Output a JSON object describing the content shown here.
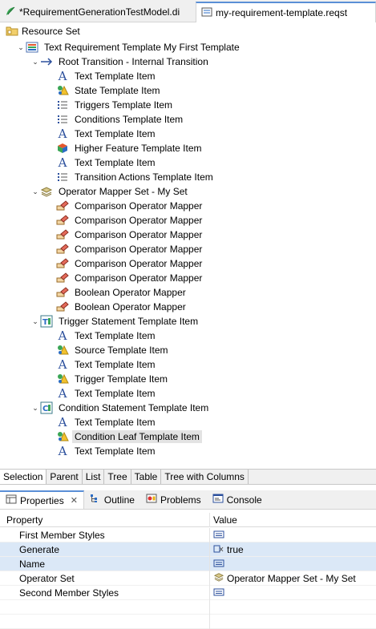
{
  "editor_tabs": [
    {
      "label": "*RequirementGenerationTestModel.di",
      "icon": "papyrus-icon"
    },
    {
      "label": "my-requirement-template.reqst",
      "icon": "reqst-icon"
    }
  ],
  "resource_set": {
    "label": "Resource Set",
    "icon": "resource-set-icon"
  },
  "tree": [
    {
      "label": "Text Requirement Template My First Template",
      "icon": "template-icon",
      "depth": 1,
      "expanded": true
    },
    {
      "label": "Root Transition - Internal Transition",
      "icon": "transition-arrow-icon",
      "depth": 2,
      "expanded": true
    },
    {
      "label": "Text Template Item",
      "icon": "text-a-icon",
      "depth": 3
    },
    {
      "label": "State Template Item",
      "icon": "state-icon",
      "depth": 3
    },
    {
      "label": "Triggers Template Item",
      "icon": "list-icon",
      "depth": 3
    },
    {
      "label": "Conditions Template Item",
      "icon": "list-icon",
      "depth": 3
    },
    {
      "label": "Text Template Item",
      "icon": "text-a-icon",
      "depth": 3
    },
    {
      "label": "Higher Feature Template Item",
      "icon": "cube-icon",
      "depth": 3
    },
    {
      "label": "Text Template Item",
      "icon": "text-a-icon",
      "depth": 3
    },
    {
      "label": "Transition Actions Template Item",
      "icon": "list-icon",
      "depth": 3
    },
    {
      "label": "Operator Mapper Set - My Set",
      "icon": "mapper-set-icon",
      "depth": 2,
      "expanded": true
    },
    {
      "label": "Comparison Operator Mapper",
      "icon": "mapper-icon",
      "depth": 3
    },
    {
      "label": "Comparison Operator Mapper",
      "icon": "mapper-icon",
      "depth": 3
    },
    {
      "label": "Comparison Operator Mapper",
      "icon": "mapper-icon",
      "depth": 3
    },
    {
      "label": "Comparison Operator Mapper",
      "icon": "mapper-icon",
      "depth": 3
    },
    {
      "label": "Comparison Operator Mapper",
      "icon": "mapper-icon",
      "depth": 3
    },
    {
      "label": "Comparison Operator Mapper",
      "icon": "mapper-icon",
      "depth": 3
    },
    {
      "label": "Boolean Operator Mapper",
      "icon": "mapper-icon",
      "depth": 3
    },
    {
      "label": "Boolean Operator Mapper",
      "icon": "mapper-icon",
      "depth": 3
    },
    {
      "label": "Trigger Statement Template Item",
      "icon": "trigger-statement-icon",
      "depth": 2,
      "expanded": true
    },
    {
      "label": "Text Template Item",
      "icon": "text-a-icon",
      "depth": 3
    },
    {
      "label": "Source Template Item",
      "icon": "state-icon",
      "depth": 3
    },
    {
      "label": "Text Template Item",
      "icon": "text-a-icon",
      "depth": 3
    },
    {
      "label": "Trigger Template Item",
      "icon": "state-icon",
      "depth": 3
    },
    {
      "label": "Text Template Item",
      "icon": "text-a-icon",
      "depth": 3
    },
    {
      "label": "Condition Statement Template Item",
      "icon": "condition-statement-icon",
      "depth": 2,
      "expanded": true
    },
    {
      "label": "Text Template Item",
      "icon": "text-a-icon",
      "depth": 3
    },
    {
      "label": "Condition Leaf Template Item",
      "icon": "state-icon",
      "depth": 3,
      "selected": true
    },
    {
      "label": "Text Template Item",
      "icon": "text-a-icon",
      "depth": 3
    }
  ],
  "viewer_tabs": [
    "Selection",
    "Parent",
    "List",
    "Tree",
    "Table",
    "Tree with Columns"
  ],
  "view_tabs": [
    {
      "label": "Properties",
      "icon": "properties-icon",
      "active": true
    },
    {
      "label": "Outline",
      "icon": "outline-icon"
    },
    {
      "label": "Problems",
      "icon": "problems-icon"
    },
    {
      "label": "Console",
      "icon": "console-icon"
    }
  ],
  "properties": {
    "header": {
      "property": "Property",
      "value": "Value"
    },
    "rows": [
      {
        "property": "First Member Styles",
        "value": "",
        "value_icon": "list-value-icon"
      },
      {
        "property": "Generate",
        "value": "true",
        "value_icon": "boolean-value-icon",
        "highlight": true
      },
      {
        "property": "Name",
        "value": "",
        "value_icon": "list-value-icon",
        "highlight": true
      },
      {
        "property": "Operator Set",
        "value": "Operator Mapper Set - My Set",
        "value_icon": "mapper-set-icon"
      },
      {
        "property": "Second Member Styles",
        "value": "",
        "value_icon": "list-value-icon"
      }
    ]
  },
  "colors": {
    "accent": "#5a8fd6",
    "selection": "#e3e3e3",
    "row_highlight": "#dbe8f7"
  }
}
